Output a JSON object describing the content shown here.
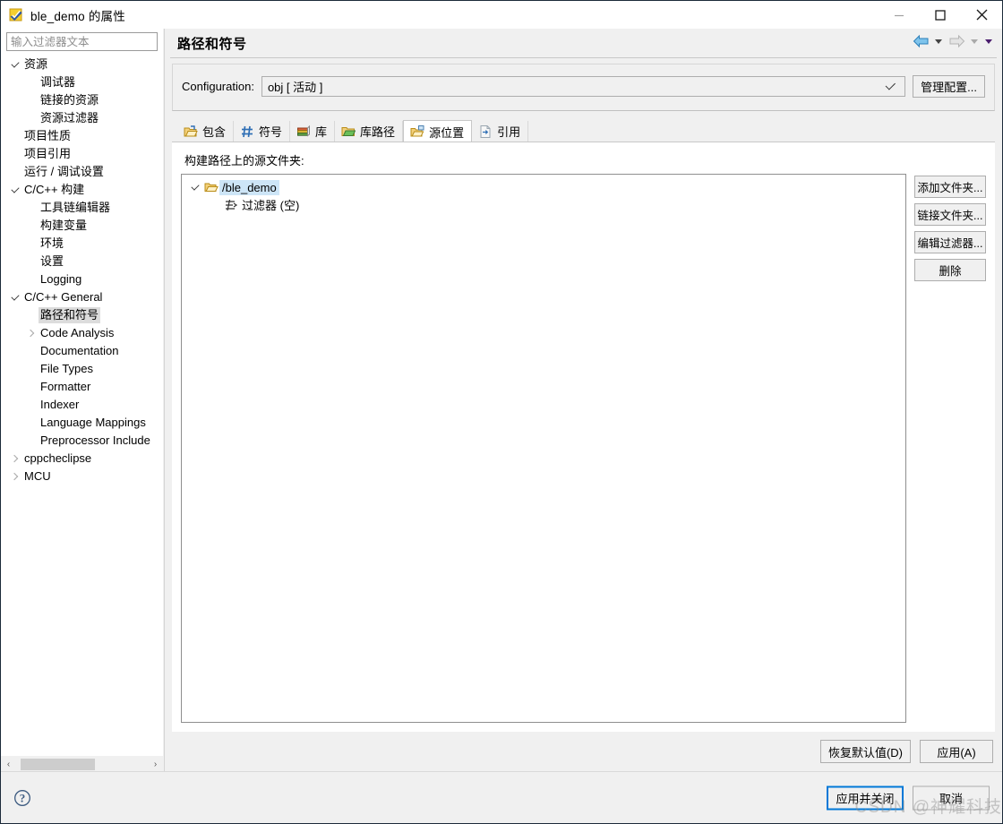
{
  "window": {
    "title": "ble_demo 的属性",
    "icon": "properties-checkmark-icon",
    "minimize_label": "—",
    "maximize_label": "☐",
    "close_label": "✕"
  },
  "sidebar": {
    "filter_placeholder": "输入过滤器文本",
    "filter_value": "",
    "items": [
      {
        "label": "资源",
        "indent": 0,
        "state": "expanded",
        "selected": false
      },
      {
        "label": "调试器",
        "indent": 1,
        "state": "leaf",
        "selected": false
      },
      {
        "label": "链接的资源",
        "indent": 1,
        "state": "leaf",
        "selected": false
      },
      {
        "label": "资源过滤器",
        "indent": 1,
        "state": "leaf",
        "selected": false
      },
      {
        "label": "项目性质",
        "indent": 0,
        "state": "leaf",
        "selected": false
      },
      {
        "label": "项目引用",
        "indent": 0,
        "state": "leaf",
        "selected": false
      },
      {
        "label": "运行 / 调试设置",
        "indent": 0,
        "state": "leaf",
        "selected": false
      },
      {
        "label": "C/C++ 构建",
        "indent": 0,
        "state": "expanded",
        "selected": false
      },
      {
        "label": "工具链编辑器",
        "indent": 1,
        "state": "leaf",
        "selected": false
      },
      {
        "label": "构建变量",
        "indent": 1,
        "state": "leaf",
        "selected": false
      },
      {
        "label": "环境",
        "indent": 1,
        "state": "leaf",
        "selected": false
      },
      {
        "label": "设置",
        "indent": 1,
        "state": "leaf",
        "selected": false
      },
      {
        "label": "Logging",
        "indent": 1,
        "state": "leaf",
        "selected": false
      },
      {
        "label": "C/C++ General",
        "indent": 0,
        "state": "expanded",
        "selected": false
      },
      {
        "label": "路径和符号",
        "indent": 1,
        "state": "leaf",
        "selected": true
      },
      {
        "label": "Code Analysis",
        "indent": 1,
        "state": "collapsed",
        "selected": false
      },
      {
        "label": "Documentation",
        "indent": 1,
        "state": "leaf",
        "selected": false
      },
      {
        "label": "File Types",
        "indent": 1,
        "state": "leaf",
        "selected": false
      },
      {
        "label": "Formatter",
        "indent": 1,
        "state": "leaf",
        "selected": false
      },
      {
        "label": "Indexer",
        "indent": 1,
        "state": "leaf",
        "selected": false
      },
      {
        "label": "Language Mappings",
        "indent": 1,
        "state": "leaf",
        "selected": false
      },
      {
        "label": "Preprocessor Include",
        "indent": 1,
        "state": "leaf",
        "selected": false
      },
      {
        "label": "cppcheclipse",
        "indent": 0,
        "state": "collapsed",
        "selected": false
      },
      {
        "label": "MCU",
        "indent": 0,
        "state": "collapsed",
        "selected": false
      }
    ],
    "hscroll": {
      "left_arrow": "‹",
      "right_arrow": "›"
    }
  },
  "page": {
    "title": "路径和符号",
    "nav": {
      "back_icon": "back-arrow-icon",
      "back_enabled": true,
      "forward_icon": "forward-arrow-icon",
      "forward_enabled": false
    }
  },
  "configuration": {
    "label": "Configuration:",
    "value": "obj [ 活动 ]",
    "manage_label": "管理配置..."
  },
  "tabs": [
    {
      "label": "包含",
      "icon": "include-folder-icon",
      "active": false
    },
    {
      "label": "符号",
      "icon": "hash-symbol-icon",
      "active": false
    },
    {
      "label": "库",
      "icon": "library-books-icon",
      "active": false
    },
    {
      "label": "库路径",
      "icon": "library-path-icon",
      "active": false
    },
    {
      "label": "源位置",
      "icon": "source-folder-icon",
      "active": true
    },
    {
      "label": "引用",
      "icon": "reference-file-icon",
      "active": false
    }
  ],
  "source_tab": {
    "caption": "构建路径上的源文件夹:",
    "tree": [
      {
        "label": "/ble_demo",
        "indent": 0,
        "state": "expanded",
        "icon": "open-folder-icon",
        "selected": true
      },
      {
        "label": "过滤器 (空)",
        "indent": 1,
        "state": "leaf",
        "icon": "filter-icon",
        "selected": false
      }
    ],
    "buttons": [
      {
        "label": "添加文件夹...",
        "name": "add-folder-button"
      },
      {
        "label": "链接文件夹...",
        "name": "link-folder-button"
      },
      {
        "label": "编辑过滤器...",
        "name": "edit-filter-button"
      },
      {
        "label": "删除",
        "name": "delete-button"
      }
    ]
  },
  "apply_row": {
    "restore_defaults": "恢复默认值(D)",
    "apply": "应用(A)"
  },
  "footer": {
    "help_icon": "help-question-icon",
    "apply_and_close": "应用并关闭",
    "cancel": "取消",
    "watermark": "CSDN @神耀科技"
  },
  "colors": {
    "accent": "#0078d7",
    "selection": "#cde5f7",
    "tree_selection": "#dcdcdc",
    "chrome": "#f0f0f0"
  }
}
